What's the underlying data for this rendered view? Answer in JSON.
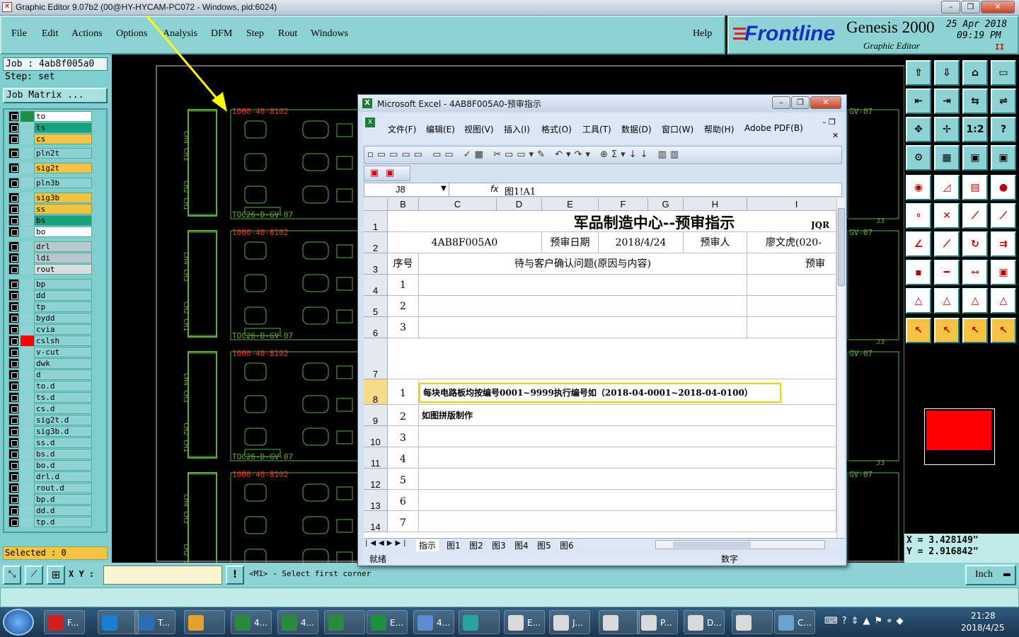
{
  "window": {
    "title": "Graphic Editor 9.07b2 (00@HY-HYCAM-PC072 - Windows, pid:6024)"
  },
  "menu": {
    "items": [
      "File",
      "Edit",
      "Actions",
      "Options",
      "Analysis",
      "DFM",
      "Step",
      "Rout",
      "Windows"
    ],
    "help": "Help"
  },
  "brand": {
    "logo": "Frontline",
    "product": "Genesis 2000",
    "subtitle": "Graphic Editor",
    "date": "25 Apr 2018",
    "time": "09:19 PM",
    "indicator": "II"
  },
  "job": {
    "job_line": "Job : 4ab8f005a0",
    "step_line": "Step: set",
    "matrix_button": "Job Matrix ..."
  },
  "layers": [
    {
      "name": "to",
      "sw": "#1e8f4a",
      "bg": "#ffffff"
    },
    {
      "name": "ts",
      "sw": "#8ed3d3",
      "bg": "#17a37d"
    },
    {
      "name": "cs",
      "sw": "#8ed3d3",
      "bg": "#f5c242"
    },
    {
      "name": "pln2t",
      "sw": "#8ed3d3",
      "bg": "#8ed3d3"
    },
    {
      "name": "sig2t",
      "sw": "#8ed3d3",
      "bg": "#f5c242"
    },
    {
      "name": "pln3b",
      "sw": "#8ed3d3",
      "bg": "#8ed3d3"
    },
    {
      "name": "sig3b",
      "sw": "#8ed3d3",
      "bg": "#f5c242"
    },
    {
      "name": "ss",
      "sw": "#8ed3d3",
      "bg": "#f5c242"
    },
    {
      "name": "bs",
      "sw": "#8ed3d3",
      "bg": "#17a37d"
    },
    {
      "name": "bo",
      "sw": "#8ed3d3",
      "bg": "#ffffff"
    },
    {
      "name": "drl",
      "sw": "#8ed3d3",
      "bg": "#b7c8cf"
    },
    {
      "name": "ldi",
      "sw": "#8ed3d3",
      "bg": "#b7c8cf"
    },
    {
      "name": "rout",
      "sw": "#8ed3d3",
      "bg": "#d8dede"
    },
    {
      "name": "bp",
      "sw": "#8ed3d3",
      "bg": "#8ed3d3"
    },
    {
      "name": "dd",
      "sw": "#8ed3d3",
      "bg": "#8ed3d3"
    },
    {
      "name": "tp",
      "sw": "#8ed3d3",
      "bg": "#8ed3d3"
    },
    {
      "name": "bydd",
      "sw": "#8ed3d3",
      "bg": "#8ed3d3"
    },
    {
      "name": "cvia",
      "sw": "#8ed3d3",
      "bg": "#8ed3d3"
    },
    {
      "name": "cslsh",
      "sw": "#ff0000",
      "bg": "#8ed3d3"
    },
    {
      "name": "v-cut",
      "sw": "#8ed3d3",
      "bg": "#8ed3d3"
    },
    {
      "name": "dwk",
      "sw": "#8ed3d3",
      "bg": "#8ed3d3"
    },
    {
      "name": "d",
      "sw": "#8ed3d3",
      "bg": "#8ed3d3"
    },
    {
      "name": "to.d",
      "sw": "#8ed3d3",
      "bg": "#8ed3d3"
    },
    {
      "name": "ts.d",
      "sw": "#8ed3d3",
      "bg": "#8ed3d3"
    },
    {
      "name": "cs.d",
      "sw": "#8ed3d3",
      "bg": "#8ed3d3"
    },
    {
      "name": "sig2t.d",
      "sw": "#8ed3d3",
      "bg": "#8ed3d3"
    },
    {
      "name": "sig3b.d",
      "sw": "#8ed3d3",
      "bg": "#8ed3d3"
    },
    {
      "name": "ss.d",
      "sw": "#8ed3d3",
      "bg": "#8ed3d3"
    },
    {
      "name": "bs.d",
      "sw": "#8ed3d3",
      "bg": "#8ed3d3"
    },
    {
      "name": "bo.d",
      "sw": "#8ed3d3",
      "bg": "#8ed3d3"
    },
    {
      "name": "drl.d",
      "sw": "#8ed3d3",
      "bg": "#8ed3d3"
    },
    {
      "name": "rout.d",
      "sw": "#8ed3d3",
      "bg": "#8ed3d3"
    },
    {
      "name": "bp.d",
      "sw": "#8ed3d3",
      "bg": "#8ed3d3"
    },
    {
      "name": "dd.d",
      "sw": "#8ed3d3",
      "bg": "#8ed3d3"
    },
    {
      "name": "tp.d",
      "sw": "#8ed3d3",
      "bg": "#8ed3d3"
    }
  ],
  "selected": "Selected : 0",
  "board_text": {
    "top_label": "1000-40-8102",
    "side_label": "TOC26-D-GV-07",
    "ch_a": "CH4 CH3",
    "ch_b": "CH2 CH1",
    "right_label": "GV-07",
    "right_code": "J3"
  },
  "coords": {
    "x": "X = 3.428149\"",
    "y": "Y = 2.916842\""
  },
  "statusbar": {
    "xy_label": "X Y :",
    "xy_value": "",
    "prompt": "<M1> - Select first corner",
    "units": "Inch"
  },
  "excel": {
    "title": "Microsoft Excel - 4AB8F005A0-预审指示",
    "menu": [
      "文件(F)",
      "编辑(E)",
      "视图(V)",
      "插入(I)",
      "格式(O)",
      "工具(T)",
      "数据(D)",
      "窗口(W)",
      "帮助(H)",
      "Adobe PDF(B)"
    ],
    "name_box": "J8",
    "formula": "图1!A1",
    "columns": [
      "B",
      "C",
      "D",
      "E",
      "F",
      "G",
      "H",
      "I"
    ],
    "row_nums": [
      "1",
      "2",
      "3",
      "4",
      "5",
      "6",
      "7",
      "8",
      "9",
      "10",
      "11",
      "12",
      "13",
      "14"
    ],
    "sheet_title": "军品制造中心--预审指示",
    "corner_code": "JQR",
    "row2": {
      "job": "4AB8F005A0",
      "date_label": "预审日期",
      "date": "2018/4/24",
      "reviewer_label": "预审人",
      "reviewer": "廖文虎(020-"
    },
    "row3": {
      "no": "序号",
      "issue": "待与客户确认问题(原因与内容)",
      "right": "预审"
    },
    "items_a": [
      "1",
      "2",
      "3"
    ],
    "items_b": [
      "1",
      "2",
      "3",
      "4",
      "5",
      "6",
      "7"
    ],
    "note1": "每块电路板均按编号0001~9999执行编号如（2018-04-0001~2018-04-0100）",
    "note2": "如图拼版制作",
    "sheets": [
      "指示",
      "图1",
      "图2",
      "图3",
      "图4",
      "图5",
      "图6"
    ],
    "status_left": "就绪",
    "status_num": "数字"
  },
  "taskbar": {
    "items": [
      "F...",
      "",
      "T...",
      "",
      "4...",
      "4...",
      "",
      "E...",
      "4...",
      "",
      "E...",
      "J...",
      "",
      "P...",
      "D...",
      "",
      "C..."
    ],
    "time": "21:28",
    "date": "2018/4/25"
  }
}
